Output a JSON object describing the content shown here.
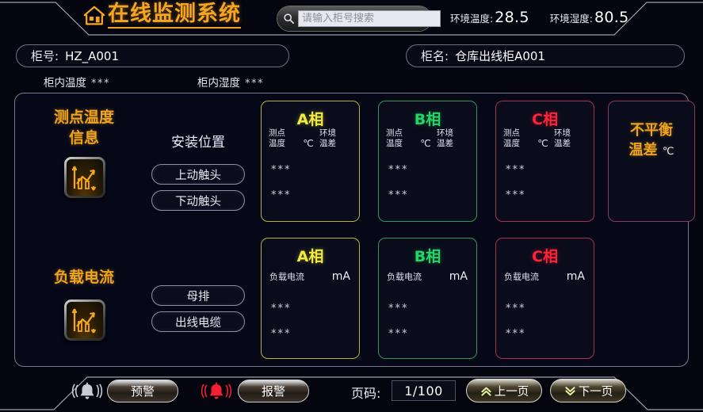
{
  "header": {
    "logo_icon": "home-icon",
    "title": "在线监测系统",
    "search": {
      "icon": "search-icon",
      "placeholder": "请输入柜号搜索",
      "value": ""
    },
    "env_temp_label": "环境温度:",
    "env_temp_value": "28.5",
    "env_humi_label": "环境湿度:",
    "env_humi_value": "80.5"
  },
  "cabinet": {
    "no_label": "柜号:",
    "no_value": "HZ_A001",
    "name_label": "柜名:",
    "name_value": "仓库出线柜A001",
    "inner_temp_label": "柜内温度",
    "inner_temp_value": "***",
    "inner_humi_label": "柜内湿度",
    "inner_humi_value": "***"
  },
  "temp_section": {
    "title_line1": "测点温度",
    "title_line2": "信息",
    "chart_icon": "line-chart-icon",
    "position_title": "安装位置",
    "loc_buttons": [
      "上动触头",
      "下动触头"
    ],
    "cards": [
      {
        "phase": "A相",
        "color": "#f2ea3c",
        "col1": "测点",
        "col1b": "温度",
        "unit": "℃",
        "col3": "环境",
        "col3b": "温差",
        "value1": "***",
        "value2": "***"
      },
      {
        "phase": "B相",
        "color": "#25d565",
        "col1": "测点",
        "col1b": "温度",
        "unit": "℃",
        "col3": "环境",
        "col3b": "温差",
        "value1": "***",
        "value2": "***"
      },
      {
        "phase": "C相",
        "color": "#fd2437",
        "col1": "测点",
        "col1b": "温度",
        "unit": "℃",
        "col3": "环境",
        "col3b": "温差",
        "value1": "***",
        "value2": "***"
      }
    ],
    "unbalance": {
      "line1": "不平衡",
      "line2": "温差",
      "unit": "℃"
    }
  },
  "current_section": {
    "title": "负载电流",
    "chart_icon": "line-chart-icon",
    "loc_buttons": [
      "母排",
      "出线电缆"
    ],
    "cards": [
      {
        "phase": "A相",
        "color": "#f2ea3c",
        "label": "负载电流",
        "unit": "mA",
        "value1": "***",
        "value2": "***"
      },
      {
        "phase": "B相",
        "color": "#25d565",
        "label": "负载电流",
        "unit": "mA",
        "value1": "***",
        "value2": "***"
      },
      {
        "phase": "C相",
        "color": "#fd2437",
        "label": "负载电流",
        "unit": "mA",
        "value1": "***",
        "value2": "***"
      }
    ]
  },
  "footer": {
    "warn_bell_icon": "bell-icon",
    "warn_label": "预警",
    "alarm_bell_icon": "bell-alert-icon",
    "alarm_label": "报警",
    "page_label": "页码:",
    "page_value": "1/100",
    "prev_icon": "chevron-up-icon",
    "prev_label": "上一页",
    "next_icon": "chevron-down-icon",
    "next_label": "下一页"
  }
}
